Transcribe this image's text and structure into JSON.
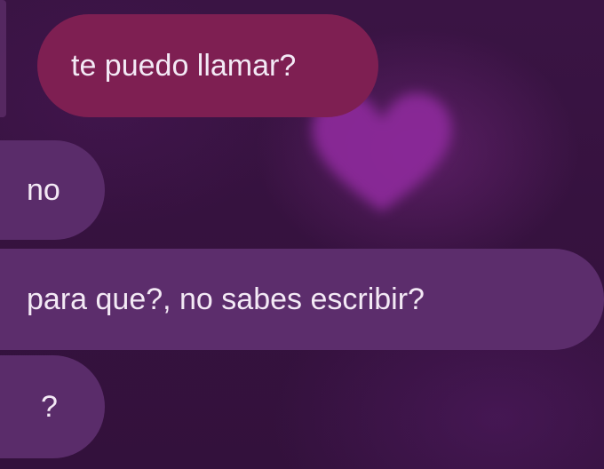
{
  "conversation": {
    "messages": [
      {
        "direction": "sent",
        "text": "te puedo llamar?"
      },
      {
        "direction": "received",
        "text": "no"
      },
      {
        "direction": "received",
        "text": "para que?, no sabes escribir?"
      },
      {
        "direction": "received",
        "text": "?"
      }
    ]
  },
  "decor": {
    "background_icon": "heart-icon"
  },
  "colors": {
    "background": "#36123f",
    "sent_bubble": "#7e1f52",
    "received_bubble": "#5a2c6a",
    "heart": "#8e2a9c",
    "text": "#f3e9f5"
  }
}
